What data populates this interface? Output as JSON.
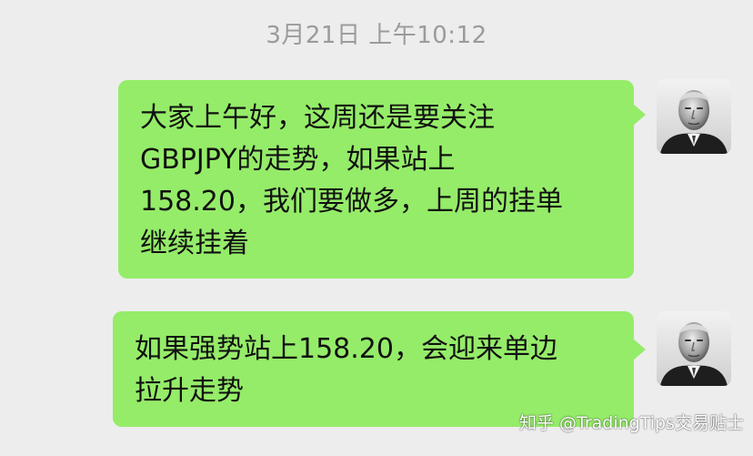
{
  "chat": {
    "timestamp": "3月21日 上午10:12",
    "messages": [
      {
        "sender": "self",
        "lines": [
          "大家上午好，这周还是要关注",
          "GBPJPY的走势，如果站上",
          "158.20，我们要做多，上周的挂单",
          "继续挂着"
        ]
      },
      {
        "sender": "self",
        "lines": [
          "如果强势站上158.20，会迎来单边",
          "拉升走势"
        ]
      }
    ]
  },
  "watermark": "知乎 @TradingTips交易贴士",
  "colors": {
    "background": "#ededed",
    "bubble": "#95ec69",
    "timestamp": "#9b9b9b",
    "text": "#111111"
  },
  "icons": {
    "avatar": "user-avatar-photo"
  }
}
